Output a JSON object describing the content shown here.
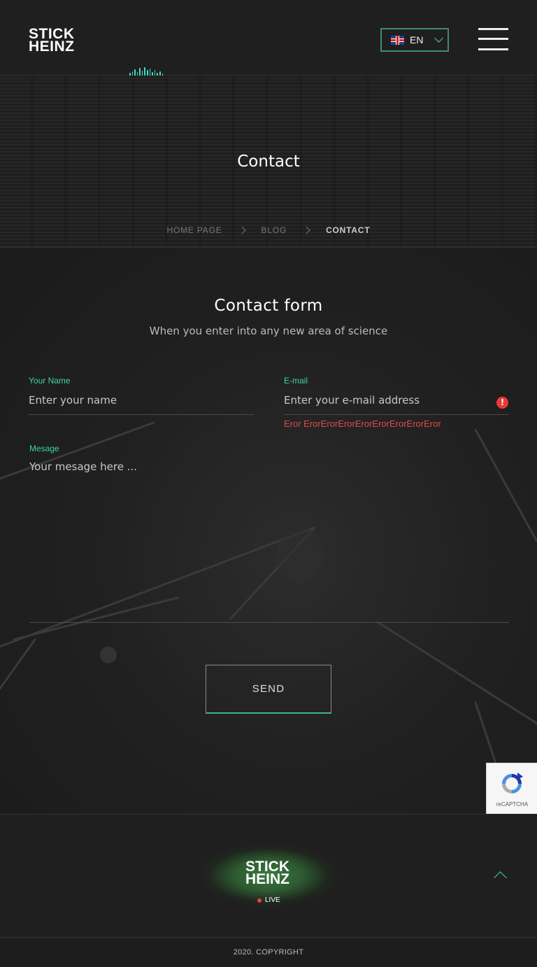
{
  "header": {
    "logo_line1": "STICK",
    "logo_line2": "HEINZ",
    "language": {
      "code": "EN",
      "flag_icon": "uk-flag-icon"
    },
    "menu_icon": "hamburger-icon"
  },
  "hero": {
    "title": "Contact",
    "breadcrumbs": [
      {
        "label": "HOME PAGE"
      },
      {
        "label": "BLOG"
      },
      {
        "label": "CONTACT"
      }
    ]
  },
  "form": {
    "title": "Contact form",
    "subtitle": "When you enter into any new area of science",
    "name": {
      "label": "Your Name",
      "placeholder": "Enter your name",
      "value": ""
    },
    "email": {
      "label": "E-mail",
      "placeholder": "Enter your e-mail address",
      "value": "",
      "error": "Eror ErorErorErorErorErorErorErorEror"
    },
    "message": {
      "label": "Mesage",
      "placeholder": "Your mesage here ...",
      "value": ""
    },
    "send_label": "SEND"
  },
  "recaptcha": {
    "label": "reCAPTCHA"
  },
  "footer": {
    "logo_line1": "STICK",
    "logo_line2": "HEINZ",
    "live_label": "LIVE",
    "copyright": "2020. COPYRIGHT"
  },
  "colors": {
    "accent": "#3dd6a6",
    "error": "#e24a4a",
    "background": "#1d1d1d"
  }
}
